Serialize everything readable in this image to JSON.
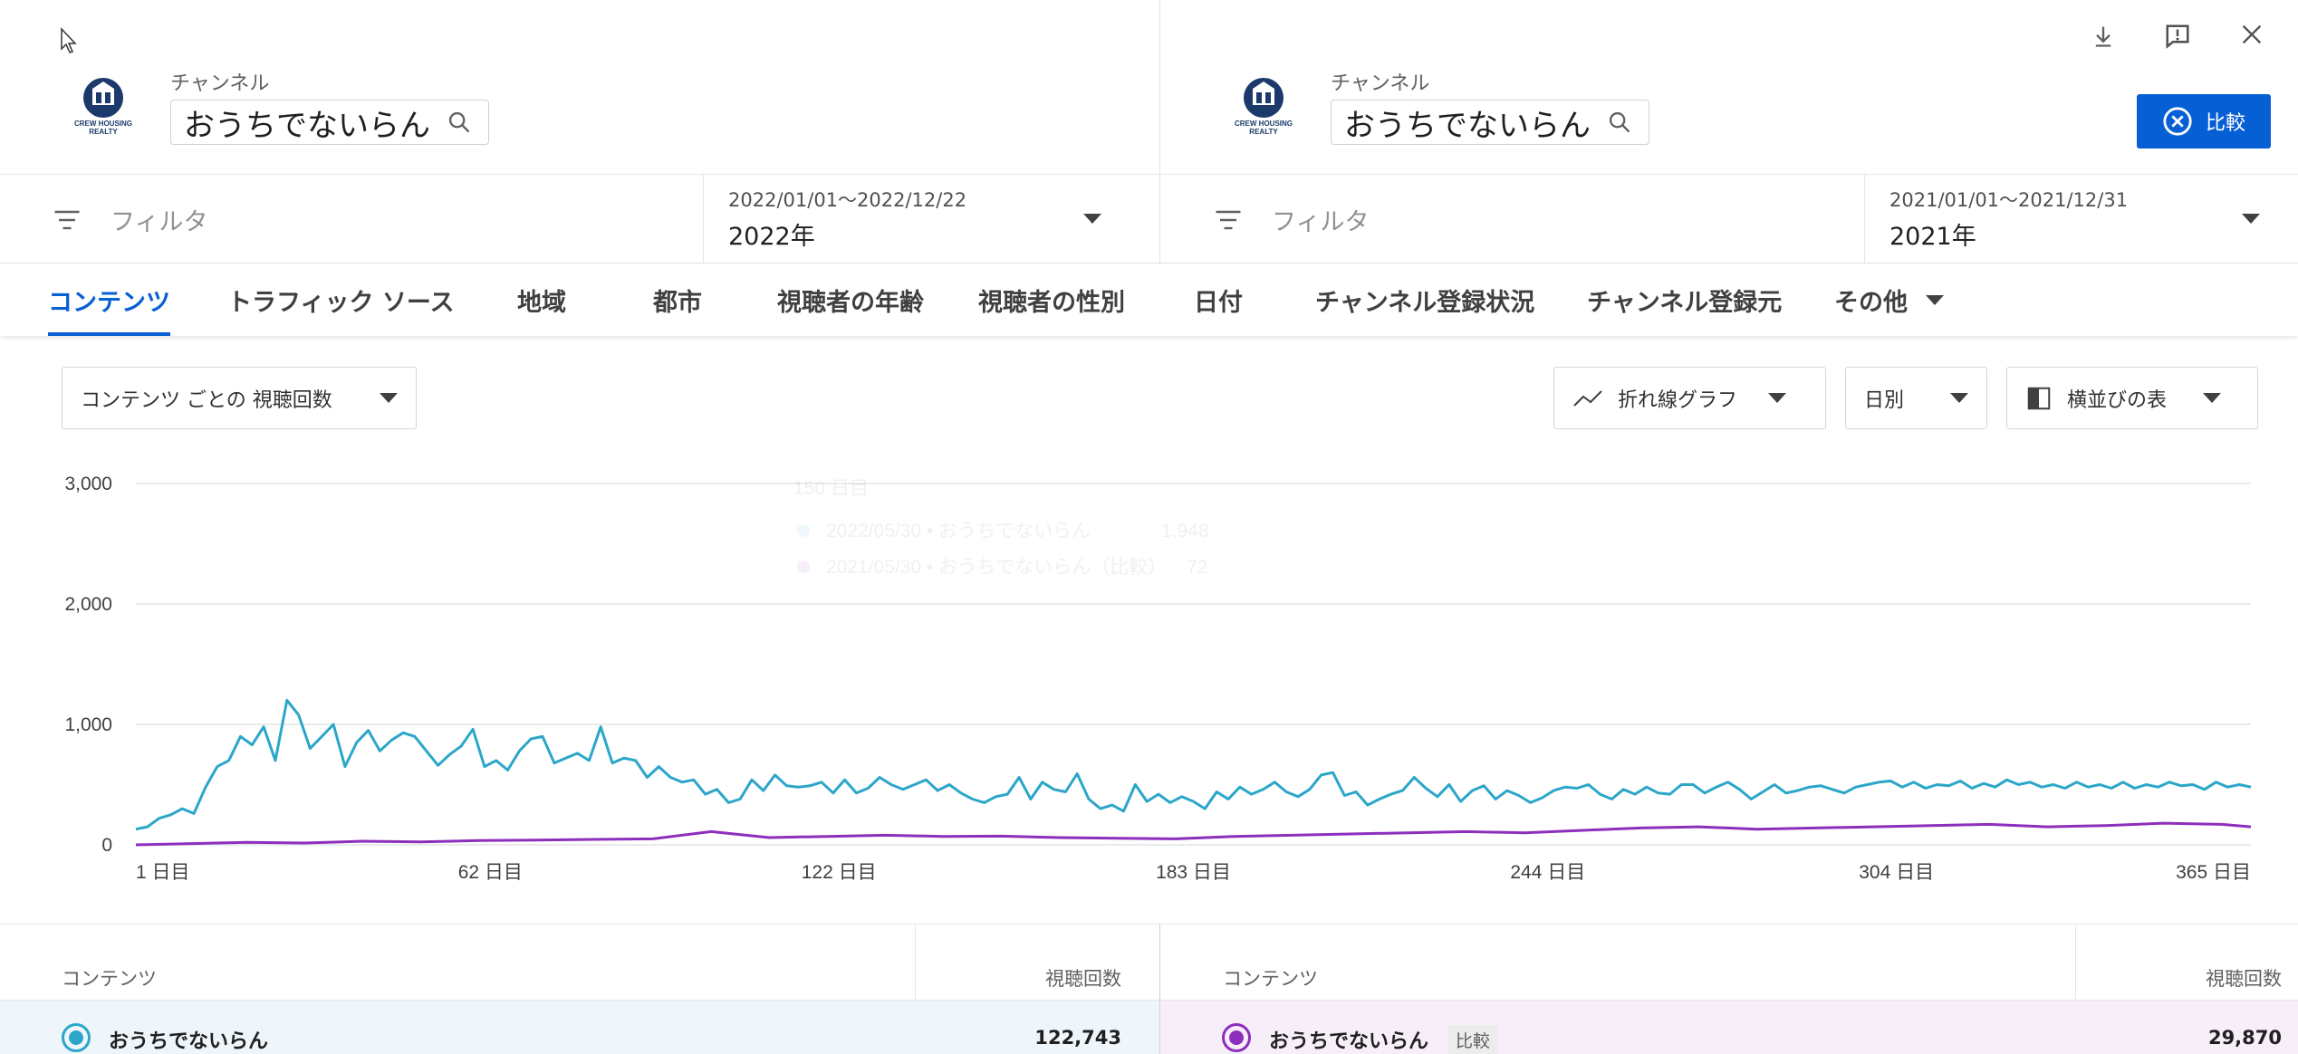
{
  "left": {
    "channel_label": "チャンネル",
    "channel_name": "おうちでないらん",
    "filter_placeholder": "フィルタ",
    "date_range": "2022/01/01～2022/12/22",
    "date_label": "2022年"
  },
  "right": {
    "channel_label": "チャンネル",
    "channel_name": "おうちでないらん",
    "filter_placeholder": "フィルタ",
    "date_range": "2021/01/01～2021/12/31",
    "date_label": "2021年"
  },
  "logo_text": [
    "CREW HOUSING",
    "REALTY"
  ],
  "compare_button": "比較",
  "tabs": [
    {
      "label": "コンテンツ",
      "active": true
    },
    {
      "label": "トラフィック ソース"
    },
    {
      "label": "地域"
    },
    {
      "label": "都市"
    },
    {
      "label": "視聴者の年齢"
    },
    {
      "label": "視聴者の性別"
    },
    {
      "label": "日付"
    },
    {
      "label": "チャンネル登録状況"
    },
    {
      "label": "チャンネル登録元"
    },
    {
      "label": "その他"
    }
  ],
  "controls": {
    "metric_select": "コンテンツ ごとの 視聴回数",
    "chart_type": "折れ線グラフ",
    "granularity": "日別",
    "layout": "横並びの表"
  },
  "tooltip": {
    "header": "150 日目",
    "rows": [
      {
        "label": "2022/05/30 • おうちでないらん",
        "value": "1,948"
      },
      {
        "label": "2021/05/30 • おうちでないらん（比較）",
        "value": "72"
      }
    ]
  },
  "chart_data": {
    "type": "line",
    "x_ticks": [
      "1 日目",
      "62 日目",
      "122 日目",
      "183 日目",
      "244 日目",
      "304 日目",
      "365 日目"
    ],
    "y_ticks": [
      "3,000",
      "2,000",
      "1,000",
      "0"
    ],
    "ylim": [
      0,
      3000
    ],
    "xlim": [
      1,
      365
    ],
    "grid": true,
    "series": [
      {
        "color": "#2ba6c9",
        "points": [
          [
            1,
            130
          ],
          [
            3,
            150
          ],
          [
            5,
            220
          ],
          [
            7,
            250
          ],
          [
            9,
            300
          ],
          [
            11,
            260
          ],
          [
            13,
            480
          ],
          [
            15,
            650
          ],
          [
            17,
            700
          ],
          [
            19,
            900
          ],
          [
            21,
            830
          ],
          [
            23,
            980
          ],
          [
            25,
            700
          ],
          [
            27,
            1200
          ],
          [
            29,
            1080
          ],
          [
            31,
            800
          ],
          [
            33,
            900
          ],
          [
            35,
            1000
          ],
          [
            37,
            650
          ],
          [
            39,
            850
          ],
          [
            41,
            950
          ],
          [
            43,
            780
          ],
          [
            45,
            870
          ],
          [
            47,
            930
          ],
          [
            49,
            900
          ],
          [
            51,
            780
          ],
          [
            53,
            660
          ],
          [
            55,
            750
          ],
          [
            57,
            820
          ],
          [
            59,
            960
          ],
          [
            61,
            650
          ],
          [
            63,
            700
          ],
          [
            65,
            620
          ],
          [
            67,
            780
          ],
          [
            69,
            880
          ],
          [
            71,
            900
          ],
          [
            73,
            680
          ],
          [
            75,
            720
          ],
          [
            77,
            760
          ],
          [
            79,
            700
          ],
          [
            81,
            980
          ],
          [
            83,
            680
          ],
          [
            85,
            720
          ],
          [
            87,
            700
          ],
          [
            89,
            560
          ],
          [
            91,
            650
          ],
          [
            93,
            560
          ],
          [
            95,
            520
          ],
          [
            97,
            540
          ],
          [
            99,
            420
          ],
          [
            101,
            460
          ],
          [
            103,
            350
          ],
          [
            105,
            380
          ],
          [
            107,
            540
          ],
          [
            109,
            450
          ],
          [
            111,
            580
          ],
          [
            113,
            490
          ],
          [
            115,
            480
          ],
          [
            117,
            490
          ],
          [
            119,
            520
          ],
          [
            121,
            430
          ],
          [
            123,
            540
          ],
          [
            125,
            430
          ],
          [
            127,
            470
          ],
          [
            129,
            560
          ],
          [
            131,
            500
          ],
          [
            133,
            460
          ],
          [
            135,
            500
          ],
          [
            137,
            540
          ],
          [
            139,
            450
          ],
          [
            141,
            500
          ],
          [
            143,
            430
          ],
          [
            145,
            380
          ],
          [
            147,
            350
          ],
          [
            149,
            400
          ],
          [
            151,
            420
          ],
          [
            153,
            560
          ],
          [
            155,
            380
          ],
          [
            157,
            520
          ],
          [
            159,
            460
          ],
          [
            161,
            440
          ],
          [
            163,
            590
          ],
          [
            165,
            380
          ],
          [
            167,
            300
          ],
          [
            169,
            330
          ],
          [
            171,
            280
          ],
          [
            173,
            500
          ],
          [
            175,
            360
          ],
          [
            177,
            420
          ],
          [
            179,
            350
          ],
          [
            181,
            400
          ],
          [
            183,
            360
          ],
          [
            185,
            300
          ],
          [
            187,
            440
          ],
          [
            189,
            380
          ],
          [
            191,
            480
          ],
          [
            193,
            420
          ],
          [
            195,
            460
          ],
          [
            197,
            520
          ],
          [
            199,
            440
          ],
          [
            201,
            400
          ],
          [
            203,
            460
          ],
          [
            205,
            580
          ],
          [
            207,
            600
          ],
          [
            209,
            410
          ],
          [
            211,
            440
          ],
          [
            213,
            330
          ],
          [
            215,
            380
          ],
          [
            217,
            420
          ],
          [
            219,
            450
          ],
          [
            221,
            560
          ],
          [
            223,
            470
          ],
          [
            225,
            400
          ],
          [
            227,
            500
          ],
          [
            229,
            360
          ],
          [
            231,
            450
          ],
          [
            233,
            490
          ],
          [
            235,
            380
          ],
          [
            237,
            450
          ],
          [
            239,
            410
          ],
          [
            241,
            350
          ],
          [
            243,
            390
          ],
          [
            245,
            450
          ],
          [
            247,
            480
          ],
          [
            249,
            470
          ],
          [
            251,
            500
          ],
          [
            253,
            420
          ],
          [
            255,
            380
          ],
          [
            257,
            460
          ],
          [
            259,
            420
          ],
          [
            261,
            480
          ],
          [
            263,
            430
          ],
          [
            265,
            420
          ],
          [
            267,
            500
          ],
          [
            269,
            500
          ],
          [
            271,
            430
          ],
          [
            273,
            480
          ],
          [
            275,
            520
          ],
          [
            277,
            460
          ],
          [
            279,
            380
          ],
          [
            281,
            440
          ],
          [
            283,
            500
          ],
          [
            285,
            430
          ],
          [
            287,
            450
          ],
          [
            289,
            480
          ],
          [
            291,
            490
          ],
          [
            293,
            460
          ],
          [
            295,
            430
          ],
          [
            297,
            480
          ],
          [
            299,
            500
          ],
          [
            301,
            520
          ],
          [
            303,
            530
          ],
          [
            305,
            480
          ],
          [
            307,
            520
          ],
          [
            309,
            470
          ],
          [
            311,
            500
          ],
          [
            313,
            490
          ],
          [
            315,
            530
          ],
          [
            317,
            470
          ],
          [
            319,
            510
          ],
          [
            321,
            480
          ],
          [
            323,
            540
          ],
          [
            325,
            500
          ],
          [
            327,
            520
          ],
          [
            329,
            480
          ],
          [
            331,
            500
          ],
          [
            333,
            470
          ],
          [
            335,
            520
          ],
          [
            337,
            480
          ],
          [
            339,
            500
          ],
          [
            341,
            470
          ],
          [
            343,
            520
          ],
          [
            345,
            470
          ],
          [
            347,
            500
          ],
          [
            349,
            480
          ],
          [
            351,
            520
          ],
          [
            353,
            490
          ],
          [
            355,
            500
          ],
          [
            357,
            460
          ],
          [
            359,
            520
          ],
          [
            361,
            480
          ],
          [
            363,
            500
          ],
          [
            365,
            480
          ]
        ]
      },
      {
        "color": "#8d2fbd",
        "points": [
          [
            1,
            0
          ],
          [
            10,
            10
          ],
          [
            20,
            20
          ],
          [
            30,
            15
          ],
          [
            40,
            30
          ],
          [
            50,
            25
          ],
          [
            60,
            35
          ],
          [
            70,
            40
          ],
          [
            80,
            45
          ],
          [
            90,
            50
          ],
          [
            100,
            110
          ],
          [
            110,
            60
          ],
          [
            120,
            70
          ],
          [
            130,
            80
          ],
          [
            140,
            70
          ],
          [
            150,
            72
          ],
          [
            160,
            60
          ],
          [
            170,
            55
          ],
          [
            180,
            50
          ],
          [
            190,
            70
          ],
          [
            200,
            80
          ],
          [
            210,
            90
          ],
          [
            220,
            100
          ],
          [
            230,
            110
          ],
          [
            240,
            100
          ],
          [
            250,
            120
          ],
          [
            260,
            140
          ],
          [
            270,
            150
          ],
          [
            280,
            130
          ],
          [
            290,
            140
          ],
          [
            300,
            150
          ],
          [
            310,
            160
          ],
          [
            320,
            170
          ],
          [
            330,
            150
          ],
          [
            340,
            160
          ],
          [
            350,
            180
          ],
          [
            360,
            170
          ],
          [
            365,
            150
          ]
        ]
      }
    ]
  },
  "table": {
    "left_header": "コンテンツ",
    "left_metric": "視聴回数",
    "right_header": "コンテンツ",
    "right_metric": "視聴回数",
    "left_row": {
      "name": "おうちでないらん",
      "value": "122,743",
      "color": "#2ba6c9"
    },
    "right_row": {
      "name": "おうちでないらん",
      "badge": "比較",
      "value": "29,870",
      "color": "#8d2fbd"
    }
  }
}
